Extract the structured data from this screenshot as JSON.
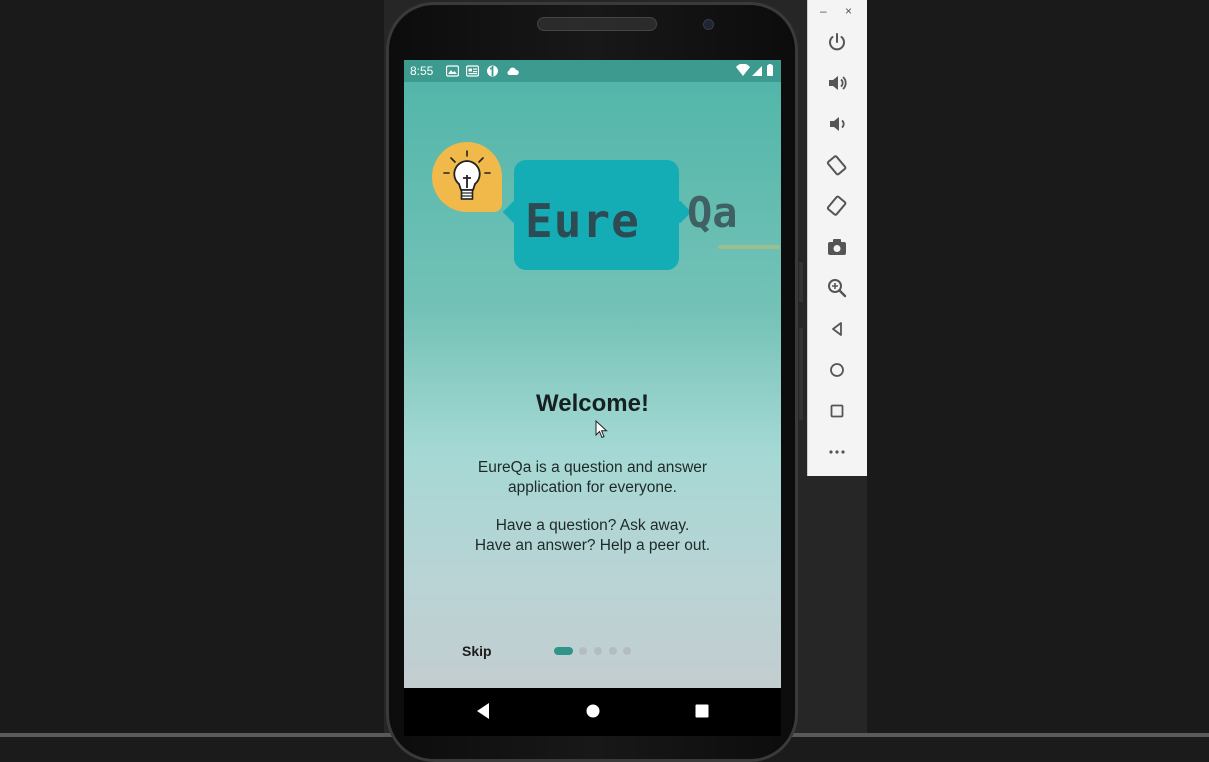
{
  "status_bar": {
    "time": "8:55"
  },
  "app": {
    "logo": {
      "left_text": "Eure",
      "right_text": "Qa"
    },
    "welcome_title": "Welcome!",
    "description_line1": "EureQa is a question and answer",
    "description_line2": "application for everyone.",
    "prompt_line1": "Have a question? Ask away.",
    "prompt_line2": "Have an answer? Help a peer out.",
    "skip_label": "Skip",
    "page_indicator": {
      "total": 5,
      "current": 1
    }
  },
  "emulator_panel": {
    "window_controls": {
      "minimize": "–",
      "close": "×"
    },
    "buttons": [
      "power-icon",
      "volume-up-icon",
      "volume-down-icon",
      "rotate-left-icon",
      "rotate-right-icon",
      "camera-icon",
      "zoom-icon",
      "back-icon",
      "home-icon",
      "overview-icon",
      "more-icon"
    ],
    "more_label": "•••"
  },
  "colors": {
    "accent": "#2f958a",
    "status_bar": "#3c9a8e",
    "logo_box": "#14adb6",
    "bulb": "#f0b94a"
  }
}
